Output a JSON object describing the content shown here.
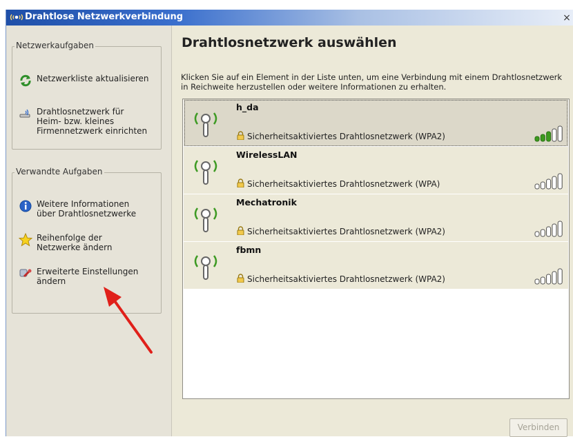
{
  "window": {
    "title": "Drahtlose Netzwerkverbindung",
    "close_label": "×"
  },
  "sidebar": {
    "network_tasks": {
      "title": "Netzwerkaufgaben",
      "items": [
        {
          "label": "Netzwerkliste aktualisieren",
          "icon": "refresh-icon"
        },
        {
          "label": "Drahtlosnetzwerk für\nHeim- bzw. kleines\nFirmennetzwerk einrichten",
          "icon": "wireless-setup-icon"
        }
      ]
    },
    "related_tasks": {
      "title": "Verwandte Aufgaben",
      "items": [
        {
          "label": "Weitere Informationen\nüber Drahtlosnetzwerke",
          "icon": "info-icon"
        },
        {
          "label": "Reihenfolge der\nNetzwerke ändern",
          "icon": "star-icon"
        },
        {
          "label": "Erweiterte Einstellungen\nändern",
          "icon": "settings-icon"
        }
      ]
    }
  },
  "main": {
    "title": "Drahtlosnetzwerk auswählen",
    "description": "Klicken Sie auf ein Element in der Liste unten, um eine Verbindung mit einem Drahtlosnetzwerk in Reichweite herzustellen oder weitere Informationen zu erhalten.",
    "networks": [
      {
        "ssid": "h_da",
        "security": "Sicherheitsaktiviertes Drahtlosnetzwerk (WPA2)",
        "signal_bars": 3,
        "selected": true
      },
      {
        "ssid": "WirelessLAN",
        "security": "Sicherheitsaktiviertes Drahtlosnetzwerk (WPA)",
        "signal_bars": 0,
        "selected": false
      },
      {
        "ssid": "Mechatronik",
        "security": "Sicherheitsaktiviertes Drahtlosnetzwerk (WPA2)",
        "signal_bars": 0,
        "selected": false
      },
      {
        "ssid": "fbmn",
        "security": "Sicherheitsaktiviertes Drahtlosnetzwerk (WPA2)",
        "signal_bars": 0,
        "selected": false
      }
    ],
    "connect_label": "Verbinden"
  },
  "colors": {
    "signal_green": "#3c9a1e",
    "signal_empty": "#ffffff",
    "arrow_red": "#e0201a",
    "title_blue": "#1f4fa8"
  }
}
